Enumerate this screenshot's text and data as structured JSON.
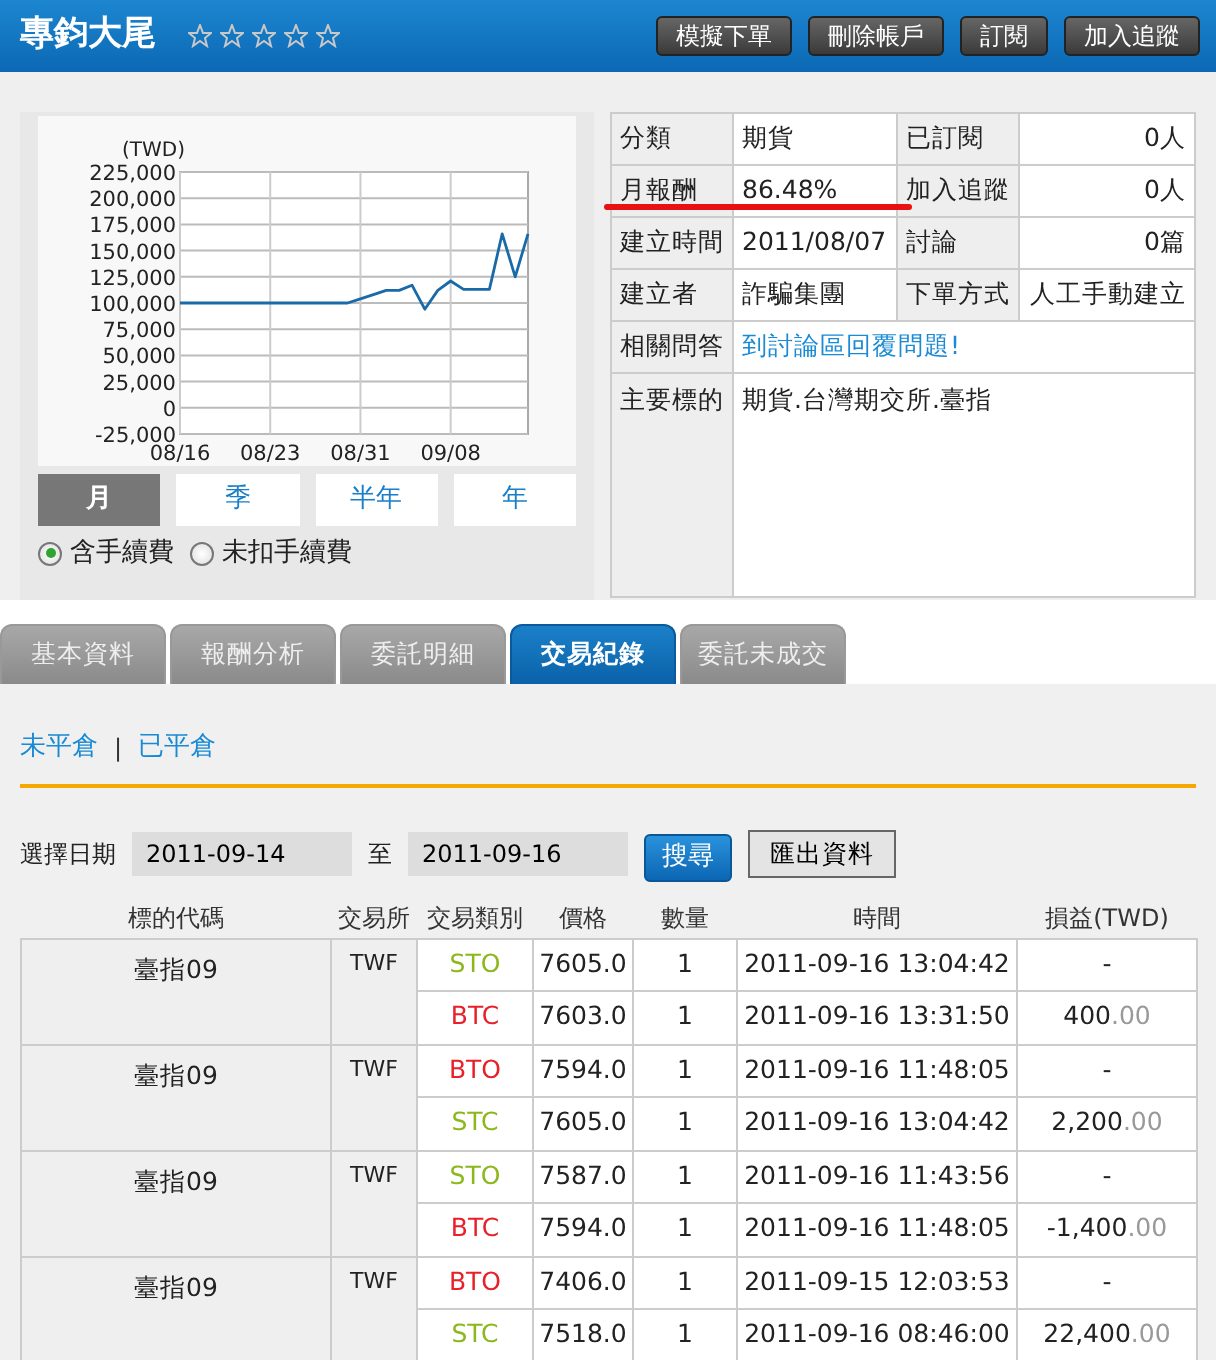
{
  "header": {
    "title": "專鈞大尾",
    "stars": 0,
    "buttons": [
      "模擬下單",
      "刪除帳戶",
      "訂閱",
      "加入追蹤"
    ]
  },
  "chart": {
    "unit": "(TWD)",
    "chart_data": {
      "type": "line",
      "grid": true,
      "categories": [
        "08/16",
        null,
        null,
        null,
        null,
        null,
        null,
        "08/23",
        null,
        null,
        null,
        null,
        null,
        null,
        "08/31",
        null,
        null,
        null,
        null,
        null,
        null,
        "09/08",
        null,
        null,
        null,
        null,
        null,
        null
      ],
      "yticks": [
        {
          "value": -25000,
          "label": "-25,000"
        },
        {
          "value": 0,
          "label": "0"
        },
        {
          "value": 25000,
          "label": "25,000"
        },
        {
          "value": 50000,
          "label": "50,000"
        },
        {
          "value": 75000,
          "label": "75,000"
        },
        {
          "value": 100000,
          "label": "100,000"
        },
        {
          "value": 125000,
          "label": "125,000"
        },
        {
          "value": 150000,
          "label": "150,000"
        },
        {
          "value": 175000,
          "label": "175,000"
        },
        {
          "value": 200000,
          "label": "200,000"
        },
        {
          "value": 225000,
          "label": "225,000"
        }
      ],
      "ylim": [
        -25000,
        225000
      ],
      "series": [
        {
          "color": "#1a6aa8",
          "values": [
            100000,
            100000,
            100000,
            100000,
            100000,
            100000,
            100000,
            100000,
            100000,
            100000,
            100000,
            100000,
            100000,
            100000,
            104000,
            108000,
            112000,
            112000,
            117000,
            94000,
            112000,
            121000,
            113000,
            113000,
            113000,
            166000,
            125000,
            166000
          ]
        }
      ]
    }
  },
  "periods": [
    {
      "label": "月",
      "selected": true
    },
    {
      "label": "季",
      "selected": false
    },
    {
      "label": "半年",
      "selected": false
    },
    {
      "label": "年",
      "selected": false
    }
  ],
  "fee_options": [
    {
      "label": "含手續費",
      "selected": true
    },
    {
      "label": "未扣手續費",
      "selected": false
    }
  ],
  "info": [
    {
      "label": "分類",
      "value": "期貨",
      "label2": "已訂閱",
      "value2": "0人",
      "highlighted": false
    },
    {
      "label": "月報酬",
      "value": "86.48%",
      "label2": "加入追蹤",
      "value2": "0人",
      "highlighted": true
    },
    {
      "label": "建立時間",
      "value": "2011/08/07",
      "label2": "討論",
      "value2": "0篇",
      "highlighted": false
    },
    {
      "label": "建立者",
      "value": "詐騙集團",
      "label2": "下單方式",
      "value2": "人工手動建立",
      "highlighted": false
    },
    {
      "label": "相關問答",
      "link": "到討論區回覆問題!",
      "highlighted": false
    },
    {
      "label": "主要標的",
      "value": "期貨.台灣期交所.臺指",
      "highlighted": false
    }
  ],
  "tabs": [
    {
      "label": "基本資料",
      "selected": false
    },
    {
      "label": "報酬分析",
      "selected": false
    },
    {
      "label": "委託明細",
      "selected": false
    },
    {
      "label": "交易紀錄",
      "selected": true
    },
    {
      "label": "委託未成交",
      "selected": false
    }
  ],
  "position_links": [
    "未平倉",
    "已平倉"
  ],
  "link_separator": "|",
  "date_filter": {
    "label": "選擇日期",
    "from": "2011-09-14",
    "separator": "至",
    "to": "2011-09-16",
    "search_button": "搜尋",
    "export_button": "匯出資料"
  },
  "table": {
    "columns": [
      "標的代碼",
      "交易所",
      "交易類別",
      "價格",
      "數量",
      "時間",
      "損益(TWD)"
    ],
    "groups": [
      {
        "symbol": "臺指09",
        "exchange": "TWF",
        "trades": [
          {
            "type": "STO",
            "color": "#8cb81c",
            "price": "7605.0",
            "qty": "1",
            "time": "2011-09-16 13:04:42",
            "pnl": "-"
          },
          {
            "type": "BTC",
            "color": "#e8202a",
            "price": "7603.0",
            "qty": "1",
            "time": "2011-09-16 13:31:50",
            "pnl": "400",
            "pnl_cents": ".00"
          }
        ]
      },
      {
        "symbol": "臺指09",
        "exchange": "TWF",
        "trades": [
          {
            "type": "BTO",
            "color": "#e8202a",
            "price": "7594.0",
            "qty": "1",
            "time": "2011-09-16 11:48:05",
            "pnl": "-"
          },
          {
            "type": "STC",
            "color": "#8cb81c",
            "price": "7605.0",
            "qty": "1",
            "time": "2011-09-16 13:04:42",
            "pnl": "2,200",
            "pnl_cents": ".00"
          }
        ]
      },
      {
        "symbol": "臺指09",
        "exchange": "TWF",
        "trades": [
          {
            "type": "STO",
            "color": "#8cb81c",
            "price": "7587.0",
            "qty": "1",
            "time": "2011-09-16 11:43:56",
            "pnl": "-"
          },
          {
            "type": "BTC",
            "color": "#e8202a",
            "price": "7594.0",
            "qty": "1",
            "time": "2011-09-16 11:48:05",
            "pnl": "-1,400",
            "pnl_cents": ".00"
          }
        ]
      },
      {
        "symbol": "臺指09",
        "exchange": "TWF",
        "trades": [
          {
            "type": "BTO",
            "color": "#e8202a",
            "price": "7406.0",
            "qty": "1",
            "time": "2011-09-15 12:03:53",
            "pnl": "-"
          },
          {
            "type": "STC",
            "color": "#8cb81c",
            "price": "7518.0",
            "qty": "1",
            "time": "2011-09-16 08:46:00",
            "pnl": "22,400",
            "pnl_cents": ".00"
          }
        ]
      }
    ]
  }
}
